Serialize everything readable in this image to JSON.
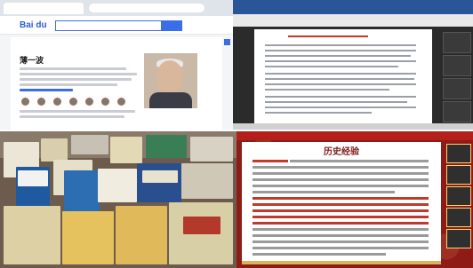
{
  "top_left": {
    "site_logo": "Bai du",
    "article_title": "薄一波"
  },
  "bottom_right": {
    "slide_heading": "历史经验"
  }
}
